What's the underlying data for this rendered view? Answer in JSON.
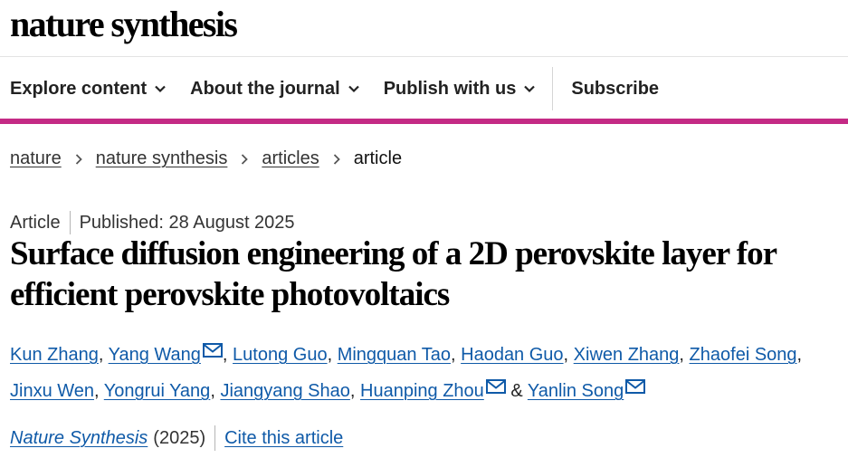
{
  "site": {
    "logo": "nature synthesis"
  },
  "nav": {
    "items": [
      {
        "label": "Explore content",
        "has_dropdown": true
      },
      {
        "label": "About the journal",
        "has_dropdown": true
      },
      {
        "label": "Publish with us",
        "has_dropdown": true
      }
    ],
    "subscribe": "Subscribe"
  },
  "accent_color": "#c42a85",
  "breadcrumb": [
    "nature",
    "nature synthesis",
    "articles",
    "article"
  ],
  "article": {
    "type": "Article",
    "published": "Published: 28 August 2025",
    "title": "Surface diffusion engineering of a 2D perovskite layer for efficient perovskite photovoltaics",
    "authors": [
      {
        "name": "Kun Zhang",
        "email_icon": false
      },
      {
        "name": "Yang Wang",
        "email_icon": true
      },
      {
        "name": "Lutong Guo",
        "email_icon": false
      },
      {
        "name": "Mingquan Tao",
        "email_icon": false
      },
      {
        "name": "Haodan Guo",
        "email_icon": false
      },
      {
        "name": "Xiwen Zhang",
        "email_icon": false
      },
      {
        "name": "Zhaofei Song",
        "email_icon": false
      },
      {
        "name": "Jinxu Wen",
        "email_icon": false
      },
      {
        "name": "Yongrui Yang",
        "email_icon": false
      },
      {
        "name": "Jiangyang Shao",
        "email_icon": false
      },
      {
        "name": "Huanping Zhou",
        "email_icon": true
      },
      {
        "name": "Yanlin Song",
        "email_icon": true
      }
    ],
    "journal": "Nature Synthesis",
    "year": "(2025)",
    "cite_label": "Cite this article"
  }
}
